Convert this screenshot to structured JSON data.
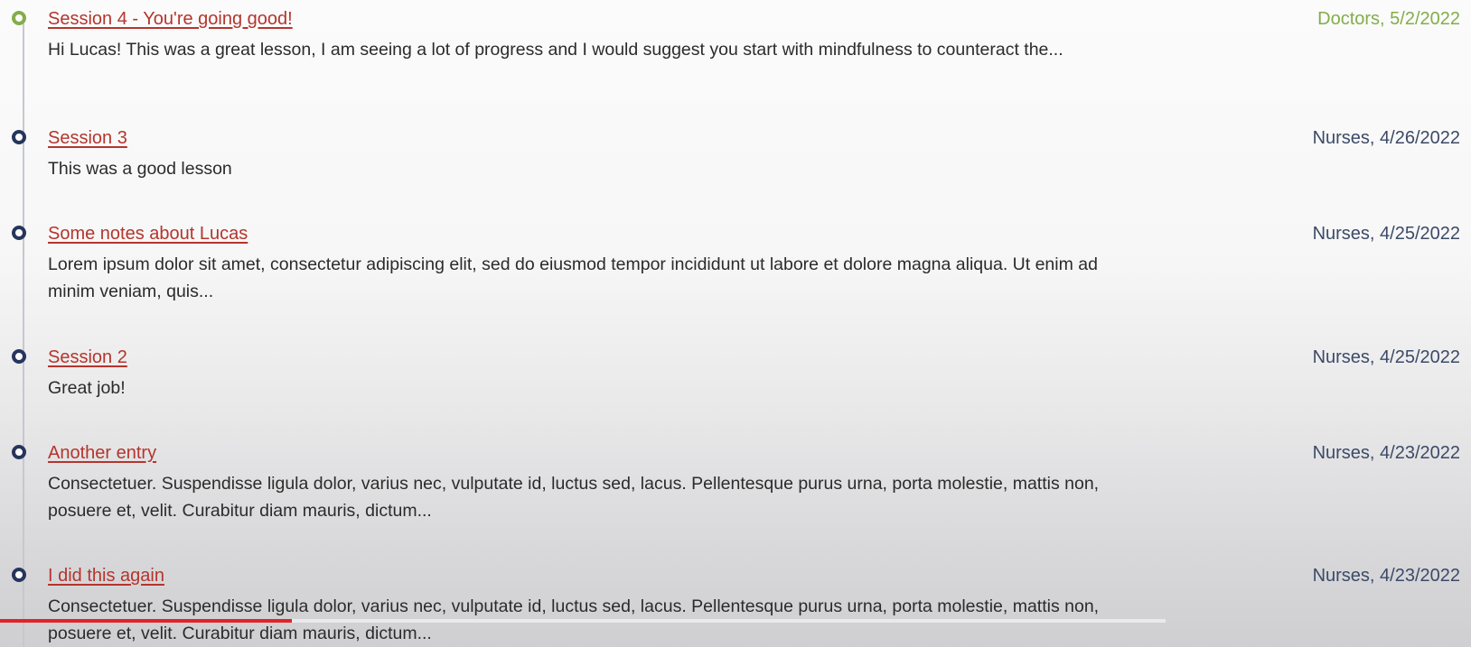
{
  "entries": [
    {
      "title": "Session 4 - You're going good!",
      "meta": "Doctors, 5/2/2022",
      "body": "Hi Lucas! This was a great lesson, I am seeing a lot of progress and I would suggest you start with mindfulness to counteract the...",
      "latest": true
    },
    {
      "title": "Session 3",
      "meta": "Nurses, 4/26/2022",
      "body": "This was a good lesson",
      "latest": false
    },
    {
      "title": "Some notes about Lucas",
      "meta": "Nurses, 4/25/2022",
      "body": "Lorem ipsum dolor sit amet, consectetur adipiscing elit, sed do eiusmod tempor incididunt ut labore et dolore magna aliqua. Ut enim ad minim veniam, quis...",
      "latest": false
    },
    {
      "title": "Session 2",
      "meta": "Nurses, 4/25/2022",
      "body": "Great job!",
      "latest": false
    },
    {
      "title": "Another entry",
      "meta": "Nurses, 4/23/2022",
      "body": "Consectetuer. Suspendisse ligula dolor, varius nec, vulputate id, luctus sed, lacus. Pellentesque purus urna, porta molestie, mattis non, posuere et, velit. Curabitur diam mauris, dictum...",
      "latest": false
    },
    {
      "title": "I did this again",
      "meta": "Nurses, 4/23/2022",
      "body": "Consectetuer. Suspendisse ligula dolor, varius nec, vulputate id, luctus sed, lacus. Pellentesque purus urna, porta molestie, mattis non, posuere et, velit. Curabitur diam mauris, dictum...",
      "latest": false
    }
  ],
  "video_progress": 0.25,
  "colors": {
    "link": "#b4352d",
    "latest_accent": "#84ad4a",
    "marker": "#26355c",
    "meta_text": "#3c4a68",
    "progress": "#e0242a"
  }
}
